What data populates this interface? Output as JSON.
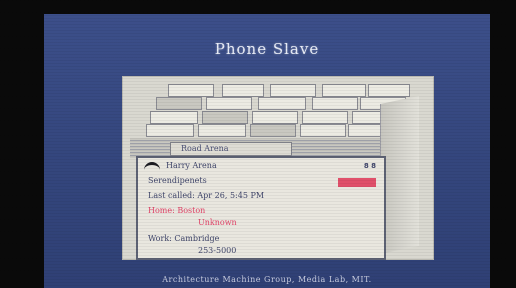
{
  "title": "Phone Slave",
  "header_tab": "Road Arena",
  "tabs_row1": [
    "",
    "",
    "",
    "",
    "",
    "",
    ""
  ],
  "card": {
    "name": "Harry Arena",
    "badge": "8 8",
    "line1": "Serendipenets",
    "line2": "Last called: Apr 26, 5:45 PM",
    "line3_label": "Home: Boston",
    "line3_sub": "Unknown",
    "line4": "Work: Cambridge",
    "line4_sub": "253-5000"
  },
  "caption": "Architecture Machine Group, Media Lab, MIT."
}
